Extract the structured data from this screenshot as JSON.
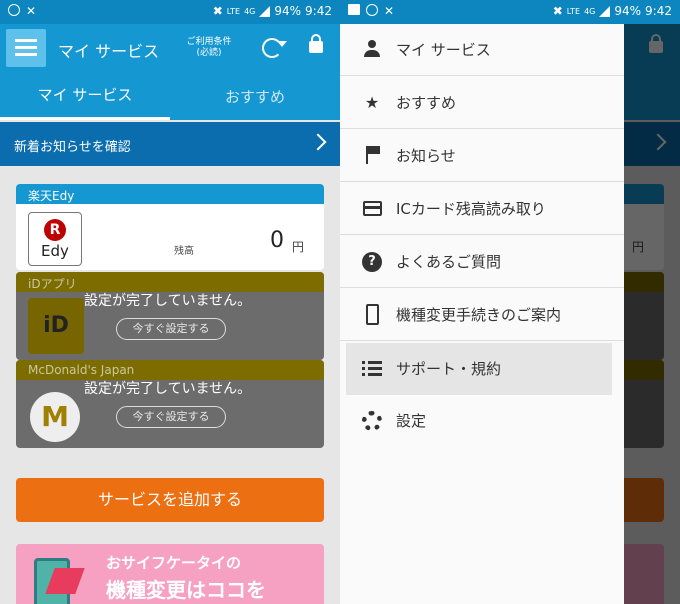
{
  "status": {
    "time": "9:42",
    "battery": "94%",
    "network": "4G",
    "network_sub": "LTE"
  },
  "appbar": {
    "title": "マイ サービス",
    "terms_line1": "ご利用条件",
    "terms_line2": "(必読)"
  },
  "tabs": [
    {
      "label": "マイ サービス"
    },
    {
      "label": "おすすめ"
    }
  ],
  "notice": {
    "label": "新着お知らせを確認"
  },
  "edy": {
    "title": "楽天Edy",
    "logo_r": "R",
    "logo_text": "Edy",
    "balance_label": "残高",
    "balance": "0",
    "unit": "円"
  },
  "idapp": {
    "title": "iDアプリ",
    "logo_text": "iD",
    "message": "設定が完了していません。",
    "button": "今すぐ設定する"
  },
  "mcd": {
    "title": "McDonald's Japan",
    "logo_text": "M",
    "message": "設定が完了していません。",
    "button": "今すぐ設定する"
  },
  "add_service": {
    "label": "サービスを追加する"
  },
  "banner": {
    "line1": "おサイフケータイの",
    "line2": "機種変更はココを"
  },
  "drawer": {
    "items": [
      {
        "label": "マイ サービス",
        "icon": "person-icon"
      },
      {
        "label": "おすすめ",
        "icon": "star-icon"
      },
      {
        "label": "お知らせ",
        "icon": "flag-icon"
      },
      {
        "label": "ICカード残高読み取り",
        "icon": "card-icon"
      },
      {
        "label": "よくあるご質問",
        "icon": "help-icon"
      },
      {
        "label": "機種変更手続きのご案内",
        "icon": "phone-icon"
      },
      {
        "label": "サポート・規約",
        "icon": "list-icon",
        "selected": true
      },
      {
        "label": "設定",
        "icon": "gear-icon"
      }
    ]
  },
  "colors": {
    "primary": "#1597d1",
    "notice": "#0b6dad",
    "add_button": "#ec6f12",
    "edy_red": "#bf0000"
  }
}
